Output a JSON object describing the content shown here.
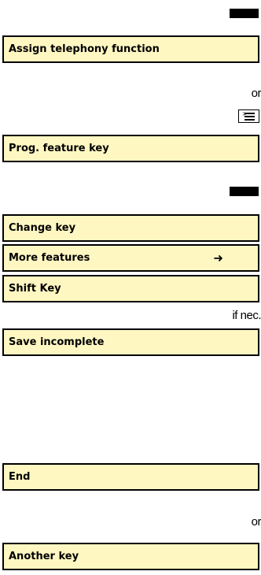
{
  "steps": {
    "assign": "Assign telephony function",
    "or_1": "or",
    "prog": "Prog. feature key",
    "change": "Change key",
    "more": "More features",
    "shift": "Shift Key",
    "if_nec": "if nec.",
    "save": "Save incomplete",
    "end": "End",
    "or_2": "or",
    "another": "Another key"
  },
  "icons": {
    "menu_key_icon": "menu-key-icon",
    "key_block": "function-key-icon",
    "arrow": "arrow-right-icon"
  },
  "colors": {
    "box_fill": "#fff7c2",
    "border": "#000000"
  }
}
